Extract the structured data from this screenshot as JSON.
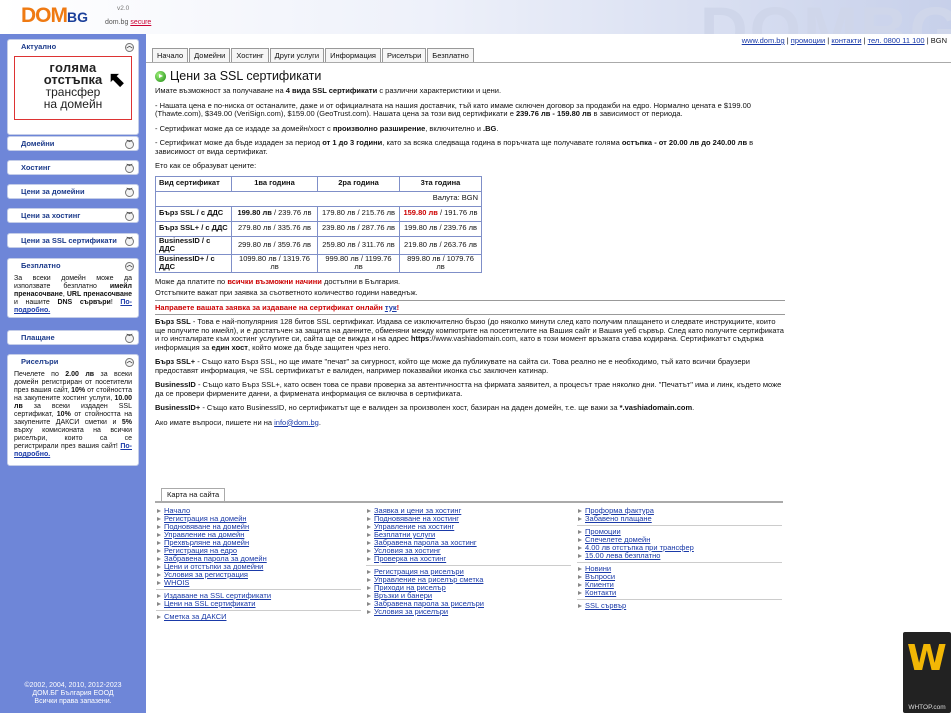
{
  "site": {
    "logo_main": "DOM",
    "logo_bg": "BG",
    "version": "v2.0",
    "subtitle": "dom.bg",
    "secure": "secure",
    "watermark": "DOMBG"
  },
  "toplinks": [
    "www.dom.bg",
    "промоции",
    "контакти",
    "тел. 0800 11 100"
  ],
  "toplinks_tail": "BGN",
  "tabs": [
    "Начало",
    "Домейни",
    "Хостинг",
    "Други услуги",
    "Информация",
    "Риселъри",
    "Безплатно"
  ],
  "sidebar": {
    "aktualno": "Актуално",
    "promo": {
      "l1": "голяма",
      "l2": "отстъпка",
      "l3": "трансфер",
      "l4": "на домейн"
    },
    "menu": [
      "Домейни",
      "Хостинг",
      "Цени за домейни",
      "Цени за хостинг",
      "Цени за SSL сертификати"
    ],
    "free": {
      "title": "Безплатно",
      "t1": "За всеки домейн може да използвате безплатно ",
      "b1": "имейл пренасочване",
      "t2": ", ",
      "b2": "URL пренасочване",
      "t3": " и нашите ",
      "b3": "DNS сървъри",
      "t4": "! ",
      "link": "По-подробно."
    },
    "payment": "Плащане",
    "resellers": {
      "title": "Риселъри",
      "t1": "Печелете по ",
      "b1": "2.00 лв",
      "t2": " за всеки домейн регистриран от посетители през вашия сайт, ",
      "b2": "10%",
      "t3": " от стойността на закупените хостинг услуги, ",
      "b3": "10.00 лв",
      "t4": " за всеки издаден SSL сертификат, ",
      "b4": "10%",
      "t5": " от стойността на закупените ДАКСИ сметки и ",
      "b5": "5%",
      "t6": " върху комисионата на всички риселъри, които са се регистрирали през вашия сайт! ",
      "link": "По-подробно."
    },
    "copyright": [
      "©2002, 2004, 2010, 2012-2023",
      "ДОМ.БГ България ЕООД",
      "Всички права запазени."
    ]
  },
  "main": {
    "title": "Цени за SSL сертификати",
    "intro_a": "Имате възможност за получаване на ",
    "intro_b": "4 вида SSL сертификати",
    "intro_c": " с различни характеристики и цени.",
    "p1_a": "- Нашата цена е по-ниска от останалите, даже и от официалната на нашия доставчик, тъй като имаме сключен договор за продажби на едро. Нормално цената е $199.00 (Thawte.com), $349.00 (VeriSign.com), $159.00 (GeoTrust.com). Нашата цена за този вид сертификати е ",
    "p1_b": "239.76 лв - 159.80 лв",
    "p1_c": " в зависимост от периода.",
    "p2_a": "- Сертификат може да се издаде за домейн/хост с ",
    "p2_b": "произволно разширение",
    "p2_c": ", включително и ",
    "p2_d": ".BG",
    "p2_e": ".",
    "p3_a": "- Сертификат може да бъде издаден за период ",
    "p3_b": "от 1 до 3 години",
    "p3_c": ", като за всяка следваща година в поръчката ще получавате голяма ",
    "p3_d": "остъпка - от 20.00 лв до 240.00 лв",
    "p3_e": " в зависимост от вида сертификат.",
    "table_intro": "Ето как се образуват цените:",
    "table": {
      "headers": [
        "Вид сертификат",
        "1ва година",
        "2ра година",
        "3та година"
      ],
      "currency": "Валута: BGN",
      "rows": [
        {
          "name": "Бърз SSL / с ДДС",
          "y1a": "199.80 лв",
          "y1b": " / 239.76 лв",
          "y2": "179.80 лв / 215.76 лв",
          "y3a": "159.80 лв",
          "y3b": " / 191.76 лв"
        },
        {
          "name": "Бърз SSL+ / с ДДС",
          "y1a": "",
          "y1b": "279.80 лв / 335.76 лв",
          "y2": "239.80 лв / 287.76 лв",
          "y3a": "",
          "y3b": "199.80 лв / 239.76 лв"
        },
        {
          "name": "BusinessID / с ДДС",
          "y1a": "",
          "y1b": "299.80 лв / 359.76 лв",
          "y2": "259.80 лв / 311.76 лв",
          "y3a": "",
          "y3b": "219.80 лв / 263.76 лв"
        },
        {
          "name": "BusinessID+ / с ДДС",
          "y1a": "",
          "y1b": "1099.80 лв / 1319.76 лв",
          "y2": "999.80 лв / 1199.76 лв",
          "y3a": "",
          "y3b": "899.80 лв / 1079.76 лв"
        }
      ]
    },
    "pay_a": "Може да платите по ",
    "pay_b": "всички възможни начини",
    "pay_c": " достъпни в България.",
    "discount_note": "Отстъпките важат при заявка за съответното количество години наведнъж.",
    "order_a": "Направете вашата заявка за издаване на сертификат онлайн ",
    "order_link": "тук",
    "order_c": "!",
    "d1_name": "Бърз SSL",
    "d1_a": " - Това е най-популярния 128 битов SSL сертификат. Издава се изключително бързо (до няколко минути след като получим плащането и следвате инструкциите, които ще получите по имейл), и е достатъчен за защита на данните, обменяни между компютрите на посетителите на Вашия сайт и Вашия уеб сървър. След като получите сертификата и го инсталирате към хостинг услугите си, сайта ще се вижда и на адрес ",
    "d1_b": "https",
    "d1_c": "://www.vashiadomain.com, като в този момент връзката става кодирана. Сертификатът съдържа информация за ",
    "d1_d": "един хост",
    "d1_e": ", който може да бъде защитен чрез него.",
    "d2_name": "Бърз SSL+",
    "d2_text": " - Също като Бърз SSL, но ще имате \"печат\" за сигурност, който ще може да публикувате на сайта си. Това реално не е необходимо, тъй като всички браузери предоставят информация, че SSL сертификатът е валиден, например показвайки иконка със заключен катинар.",
    "d3_name": "BusinessID",
    "d3_text": " - Също като Бърз SSL+, като освен това се прави проверка за автентичността на фирмата заявител, а процесът трае няколко дни. \"Печатът\" има и линк, където може да се провери фирмените данни, а фирмената информация се включва в сертификата.",
    "d4_name": "BusinessID+",
    "d4_a": " - Също като BusinessID, но сертификатът ще е валиден за произволен хост, базиран на даден домейн, т.е. ще важи за ",
    "d4_b": "*.vashiadomain.com",
    "d4_c": ".",
    "contact_a": "Ако имате въпроси, пишете ни на ",
    "contact_email": "info@dom.bg",
    "contact_c": "."
  },
  "sitemap": {
    "tab": "Карта на сайта",
    "col1a": [
      "Начало",
      "Регистрация на домейн",
      "Подновяване на домейн",
      "Управление на домейн",
      "Прехвърляне на домейн",
      "Регистрация на едро",
      "Забравена парола за домейн",
      "Цени и отстъпки за домейни",
      "Условия за регистрация",
      "WHOIS"
    ],
    "col1b": [
      "Издаване на SSL сертификати",
      "Цени на SSL сертификати"
    ],
    "col1c": [
      "Сметка за ДАКСИ"
    ],
    "col2a": [
      "Заявка и цени за хостинг",
      "Подновяване на хостинг",
      "Управление на хостинг",
      "Безплатни услуги",
      "Забравена парола за хостинг",
      "Условия за хостинг",
      "Проверка на хостинг"
    ],
    "col2b": [
      "Регистрация на риселъри",
      "Управление на риселър сметка",
      "Приходи на риселър",
      "Връзки и банери",
      "Забравена парола за риселъри",
      "Условия за риселъри"
    ],
    "col3a": [
      "Проформа фактура",
      "Забавено плащане"
    ],
    "col3b": [
      "Промоции",
      "Спечелете домейн",
      "4.00 лв отстъпка при трансфер",
      "15.00 лева безплатно"
    ],
    "col3c": [
      "Новини",
      "Въпроси",
      "Клиенти",
      "Контакти"
    ],
    "col3d": [
      "SSL сървър"
    ]
  },
  "badge": {
    "logo": "W",
    "text": "WHTOP.com"
  }
}
